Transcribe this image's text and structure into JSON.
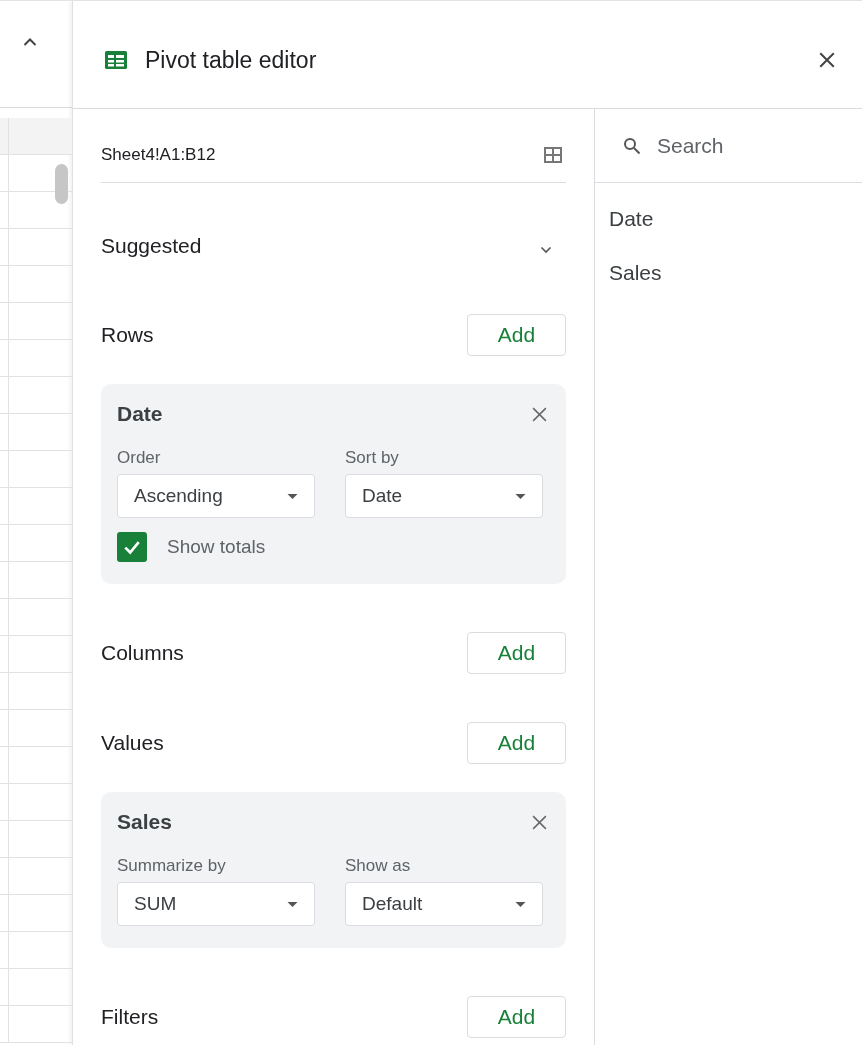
{
  "editor": {
    "title": "Pivot table editor"
  },
  "range": {
    "value": "Sheet4!A1:B12"
  },
  "suggested": {
    "label": "Suggested",
    "expanded": false
  },
  "sections": [
    {
      "label": "Rows",
      "button": "Add",
      "cards": [
        {
          "title": "Date",
          "fields": [
            {
              "label": "Order",
              "value": "Ascending"
            },
            {
              "label": "Sort by",
              "value": "Date"
            }
          ],
          "show_totals": {
            "label": "Show totals",
            "checked": true
          }
        }
      ]
    },
    {
      "label": "Columns",
      "button": "Add"
    },
    {
      "label": "Values",
      "button": "Add",
      "cards": [
        {
          "title": "Sales",
          "fields": [
            {
              "label": "Summarize by",
              "value": "SUM"
            },
            {
              "label": "Show as",
              "value": "Default"
            }
          ]
        }
      ]
    },
    {
      "label": "Filters",
      "button": "Add"
    }
  ],
  "search": {
    "placeholder": "Search"
  },
  "field_list": [
    {
      "label": "Date"
    },
    {
      "label": "Sales"
    }
  ]
}
